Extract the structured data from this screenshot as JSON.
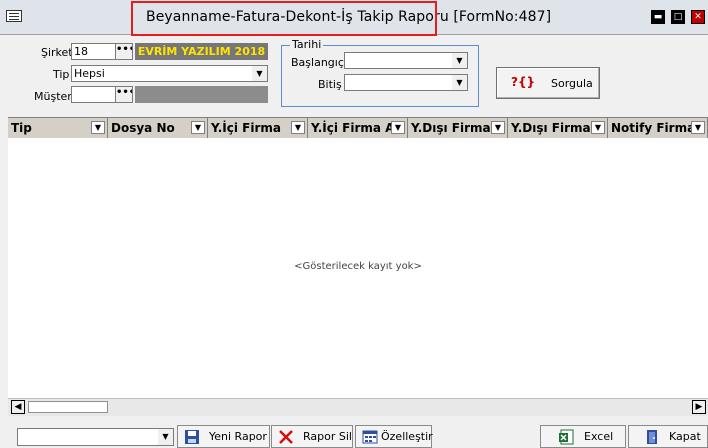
{
  "window": {
    "title": "Beyanname-Fatura-Dekont-İş Takip Raporu [FormNo:487]",
    "controls": {
      "minimize": "▬",
      "maximize": "□",
      "close": "✕"
    }
  },
  "filters": {
    "sirket_label": "Şirket",
    "sirket_value": "18",
    "company_name": "EVRİM YAZILIM 2018",
    "tip_label": "Tip",
    "tip_value": "Hepsi",
    "musteri_label": "Müşteri",
    "musteri_value": "",
    "dots": "•••"
  },
  "date_group": {
    "legend": "Tarihi",
    "start_label": "Başlangıç",
    "start_value": "",
    "end_label": "Bitiş",
    "end_value": ""
  },
  "query_button": {
    "icon_text": "?{}",
    "label": "Sorgula"
  },
  "grid": {
    "columns": [
      "Tip",
      "Dosya No",
      "Y.İçi Firma",
      "Y.İçi Firma A",
      "Y.Dışı Firma",
      "Y.Dışı Firma .",
      "Notify Firma"
    ],
    "empty_text": "<Gösterilecek kayıt yok>"
  },
  "toolbar": {
    "new_report": "Yeni Rapor",
    "delete_report": "Rapor Sil",
    "customize": "Özelleştir",
    "excel": "Excel",
    "close": "Kapat"
  },
  "colors": {
    "accent_highlight": "#e41e1e",
    "company_text": "#ffe400",
    "company_bg": "#777777",
    "group_border": "#5e8ecf"
  }
}
